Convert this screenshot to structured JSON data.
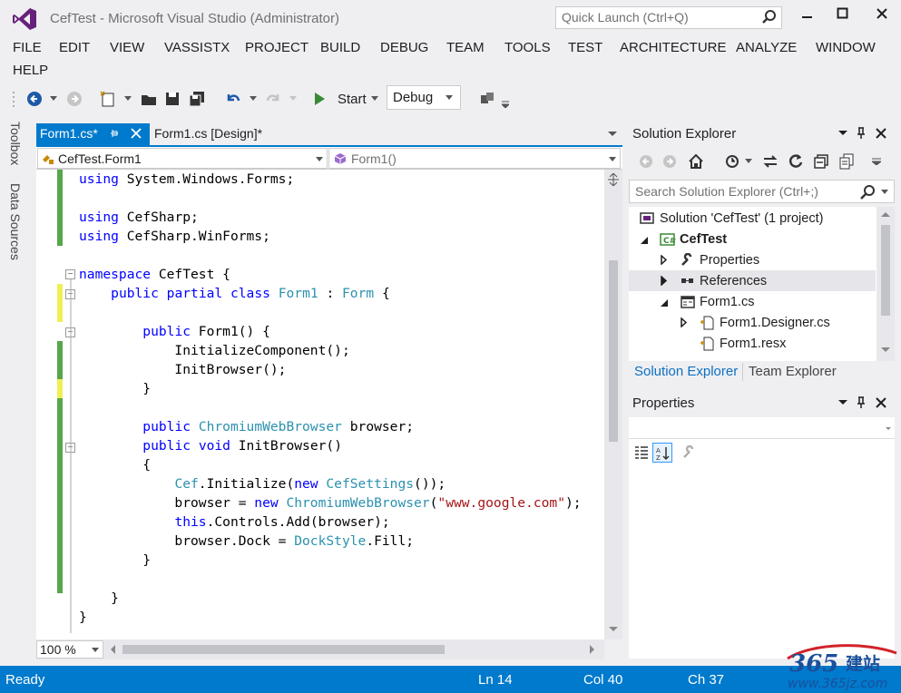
{
  "window": {
    "title": "CefTest - Microsoft Visual Studio (Administrator)",
    "quick_launch_placeholder": "Quick Launch (Ctrl+Q)",
    "minimize": "🗕",
    "maximize": "🗖",
    "close": "✕"
  },
  "menu": {
    "file": "FILE",
    "edit": "EDIT",
    "view": "VIEW",
    "vassistx": "VASSISTX",
    "project": "PROJECT",
    "build": "BUILD",
    "debug": "DEBUG",
    "team": "TEAM",
    "tools": "TOOLS",
    "test": "TEST",
    "architecture": "ARCHITECTURE",
    "analyze": "ANALYZE",
    "window": "WINDOW",
    "help": "HELP"
  },
  "toolbar": {
    "start_label": "Start",
    "config_value": "Debug"
  },
  "sidebar": {
    "toolbox": "Toolbox",
    "data_sources": "Data Sources"
  },
  "editor": {
    "tabs": [
      {
        "label": "Form1.cs*",
        "active": true
      },
      {
        "label": "Form1.cs [Design]*",
        "active": false
      }
    ],
    "class_dropdown": "CefTest.Form1",
    "member_dropdown": "Form1()",
    "zoom": "100 %"
  },
  "solution_explorer": {
    "title": "Solution Explorer",
    "search_placeholder": "Search Solution Explorer (Ctrl+;)",
    "items": [
      {
        "label": "Solution 'CefTest' (1 project)",
        "icon": "solution-icon"
      },
      {
        "label": "CefTest",
        "icon": "csharp-project-icon"
      },
      {
        "label": "Properties",
        "icon": "wrench-icon"
      },
      {
        "label": "References",
        "icon": "references-icon"
      },
      {
        "label": "Form1.cs",
        "icon": "form-icon"
      },
      {
        "label": "Form1.Designer.cs",
        "icon": "code-file-icon"
      },
      {
        "label": "Form1.resx",
        "icon": "resource-file-icon"
      }
    ],
    "tab_solution": "Solution Explorer",
    "tab_team": "Team Explorer"
  },
  "properties": {
    "title": "Properties"
  },
  "status": {
    "ready": "Ready",
    "ln": "Ln 14",
    "col": "Col 40",
    "ch": "Ch 37"
  },
  "watermark": {
    "brand": "365建站",
    "url": "www.365jz.com"
  },
  "colors": {
    "accent": "#007acc",
    "keyword": "#0000ff",
    "type": "#2b91af",
    "string": "#a31515"
  }
}
